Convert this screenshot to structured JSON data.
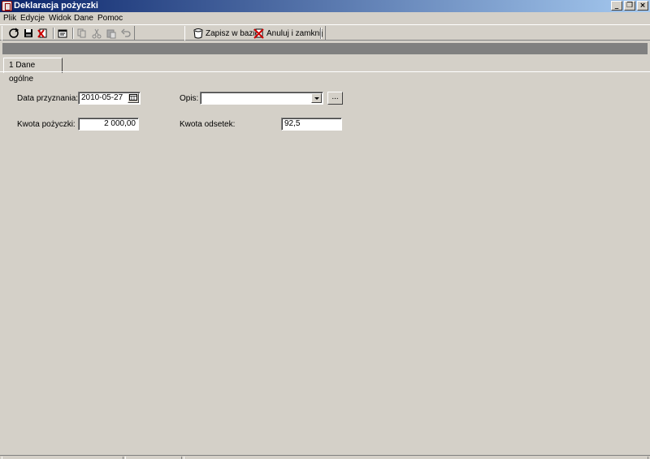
{
  "window": {
    "title": "Deklaracja pożyczki",
    "controls": [
      "_",
      "❐",
      "×"
    ]
  },
  "menu": [
    "Plik",
    "Edycje",
    "Widok",
    "Dane",
    "Pomoc"
  ],
  "toolbar": {
    "save_label": "Zapisz w bazie",
    "cancel_label": "Anuluj i zamknij"
  },
  "tabs": [
    {
      "label": "1 Dane ogólne",
      "active": true
    }
  ],
  "form": {
    "date_label": "Data przyznania:",
    "date_value": "2010-05-27",
    "amount_label": "Kwota pożyczki:",
    "amount_value": "2 000,00",
    "desc_label": "Opis:",
    "desc_value": "",
    "ellipsis_label": "...",
    "interest_label": "Kwota odsetek:",
    "interest_value": "92,5"
  },
  "colors": {
    "window_bg": "#d4d0c8",
    "titlebar_start": "#0a246a",
    "titlebar_end": "#a6caf0",
    "greybar": "#808080"
  }
}
